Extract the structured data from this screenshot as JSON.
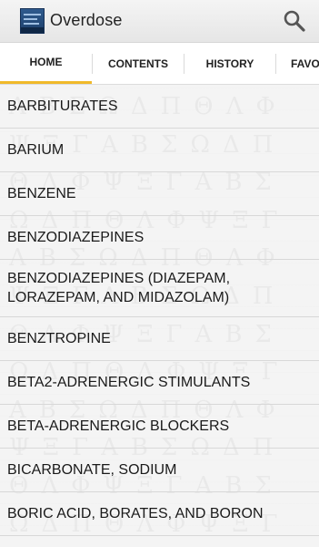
{
  "app": {
    "title": "Overdose",
    "icon": "app-book-icon"
  },
  "header": {
    "search_icon": "search-icon"
  },
  "tabs": [
    {
      "label": "HOME",
      "active": true
    },
    {
      "label": "CONTENTS",
      "active": false
    },
    {
      "label": "HISTORY",
      "active": false
    },
    {
      "label": "FAVOU",
      "active": false
    }
  ],
  "list": {
    "items": [
      {
        "label": "BARBITURATES"
      },
      {
        "label": "BARIUM"
      },
      {
        "label": "BENZENE"
      },
      {
        "label": "BENZODIAZEPINES"
      },
      {
        "label": "BENZODIAZEPINES (DIAZEPAM, LORAZEPAM, AND MIDAZOLAM)"
      },
      {
        "label": "BENZTROPINE"
      },
      {
        "label": "BETA2-ADRENERGIC STIMULANTS"
      },
      {
        "label": "BETA-ADRENERGIC BLOCKERS"
      },
      {
        "label": "BICARBONATE, SODIUM"
      },
      {
        "label": "BORIC ACID, BORATES, AND BORON"
      }
    ]
  },
  "colors": {
    "accent": "#f0b92a",
    "background": "#f4f4f4"
  }
}
